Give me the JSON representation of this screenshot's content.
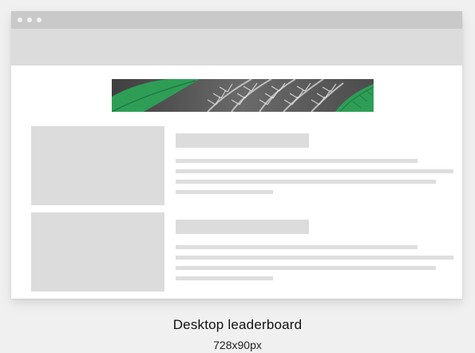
{
  "caption": {
    "title": "Desktop leaderboard",
    "size": "728x90px"
  },
  "colors": {
    "banner_green": "#2e9e57",
    "banner_leaf_gray": "#bdbdbd",
    "placeholder_gray": "#dcdcdc",
    "titlebar_gray": "#c9c9c9"
  },
  "icons": {
    "window_dots": [
      "window-dot-icon",
      "window-dot-icon",
      "window-dot-icon"
    ]
  }
}
